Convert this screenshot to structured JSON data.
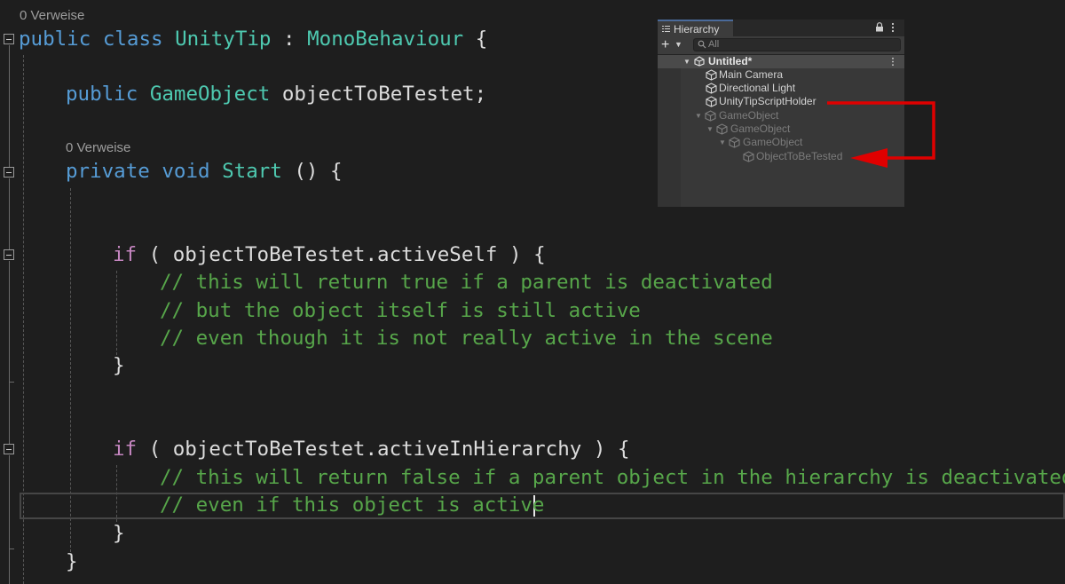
{
  "editor": {
    "lens_class": "0 Verweise",
    "lens_method": "0 Verweise",
    "class_decl": {
      "public": "public",
      "class": "class",
      "name": "UnityTip",
      "colon": ":",
      "base": "MonoBehaviour",
      "brace": "{"
    },
    "field_decl": {
      "public": "public",
      "type": "GameObject",
      "name": "objectToBeTestet;"
    },
    "method_decl": {
      "private": "private",
      "void": "void",
      "name": "Start",
      "rest": "() {"
    },
    "if1": {
      "kw": "if",
      "open": "(",
      "expr": "objectToBeTestet.activeSelf",
      "close": ") {"
    },
    "if1_comments": [
      "// this will return true if a parent is deactivated",
      "// but the object itself is still active",
      "// even though it is not really active in the scene"
    ],
    "close_brace": "}",
    "if2": {
      "kw": "if",
      "open": "(",
      "expr": "objectToBeTestet.activeInHierarchy",
      "close": ") {"
    },
    "if2_comments": [
      "// this will return false if a parent object in the hierarchy is deactivated",
      "// even if this object is active"
    ]
  },
  "hierarchy": {
    "tab_title": "Hierarchy",
    "search_placeholder": "All",
    "scene_name": "Untitled*",
    "items": [
      {
        "label": "Main Camera",
        "active": true
      },
      {
        "label": "Directional Light",
        "active": true
      },
      {
        "label": "UnityTipScriptHolder",
        "active": true
      },
      {
        "label": "GameObject",
        "active": false
      },
      {
        "label": "GameObject",
        "active": false
      },
      {
        "label": "GameObject",
        "active": false
      },
      {
        "label": "ObjectToBeTested",
        "active": false
      }
    ],
    "tab_menu_icon": "list-icon",
    "lock_icon": "lock-icon",
    "menu_icon": "kebab-icon"
  },
  "colors": {
    "editor_bg": "#1e1e1e",
    "keyword": "#569cd6",
    "control": "#c586c0",
    "type": "#4ec9b0",
    "comment": "#57a64a",
    "annotation_arrow": "#e00000"
  }
}
